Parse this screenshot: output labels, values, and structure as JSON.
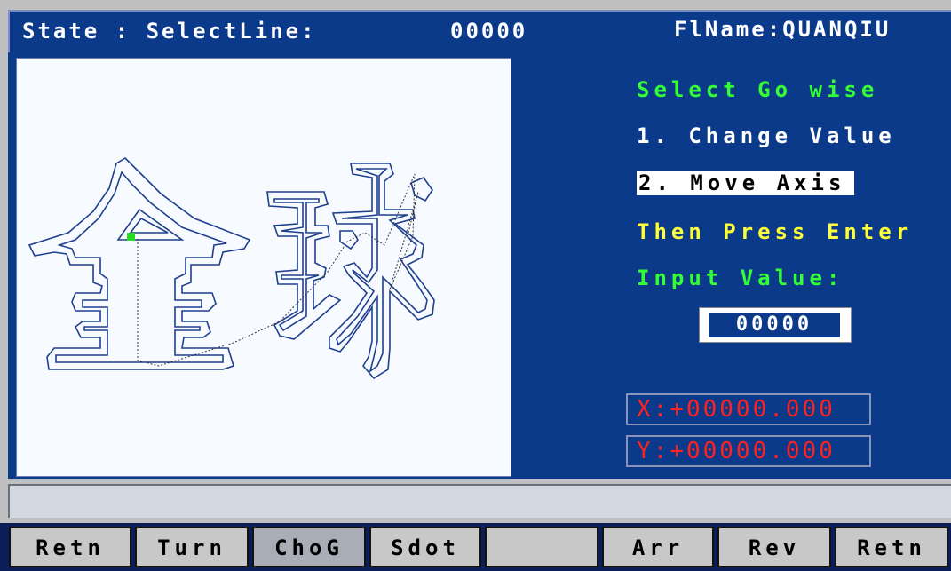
{
  "header": {
    "state_label": "State : SelectLine:",
    "line_number": "00000",
    "file_name": "FlName:QUANQIU"
  },
  "panel": {
    "prompt": "Select Go wise",
    "option1": "1. Change Value",
    "option2": "2. Move Axis",
    "then": "Then Press Enter",
    "input_label": "Input Value:",
    "input_value": "00000",
    "x_coord": "X:+00000.000",
    "y_coord": "Y:+00000.000"
  },
  "status_text": "",
  "fkeys": [
    {
      "label": "Retn"
    },
    {
      "label": "Turn"
    },
    {
      "label": "ChoG"
    },
    {
      "label": "Sdot"
    },
    {
      "label": ""
    },
    {
      "label": "Arr"
    },
    {
      "label": "Rev"
    },
    {
      "label": "Retn"
    }
  ],
  "colors": {
    "panel_bg": "#0c3a8a",
    "prompt_green": "#34ff34",
    "highlight_yellow": "#ffff3a",
    "coord_red": "#ff2020",
    "start_marker": "#22dd22"
  }
}
